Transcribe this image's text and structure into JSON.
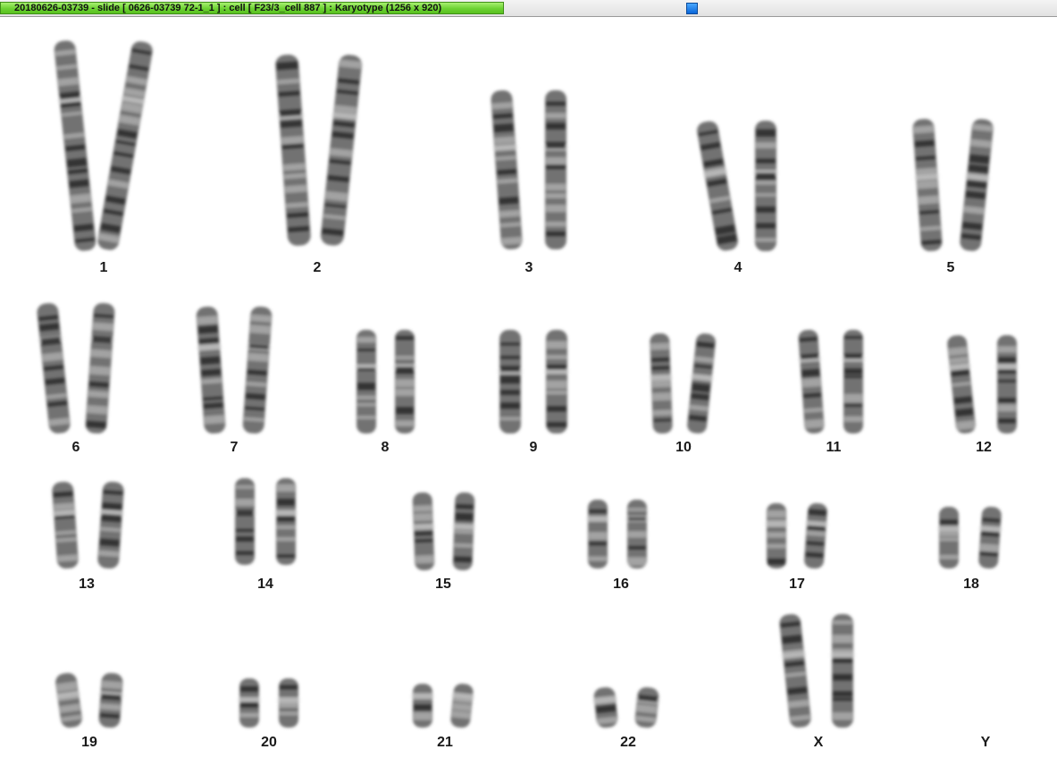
{
  "window": {
    "title": "20180626-03739 - slide [ 0626-03739 72-1_1 ] : cell [ F23/3_cell 887 ] : Karyotype  (1256 x 920)"
  },
  "karyotype": {
    "labels": [
      "1",
      "2",
      "3",
      "4",
      "5",
      "6",
      "7",
      "8",
      "9",
      "10",
      "11",
      "12",
      "13",
      "14",
      "15",
      "16",
      "17",
      "18",
      "19",
      "20",
      "21",
      "22",
      "X",
      "Y"
    ]
  },
  "colors": {
    "progress": "#6cd232",
    "handle": "#0a66d8",
    "chromatin": "#5a5a5a",
    "band": "#2e2e2e"
  }
}
